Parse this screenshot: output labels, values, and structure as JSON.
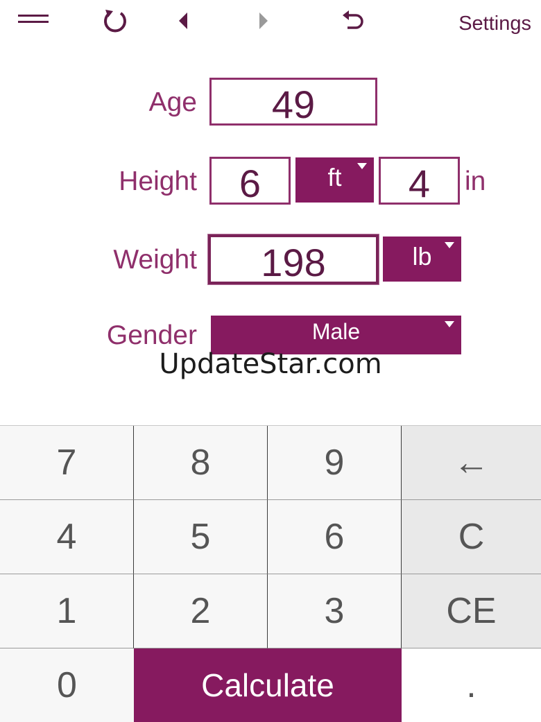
{
  "toolbar": {
    "menu_icon": "menu-icon",
    "reload_icon": "reload-icon",
    "back_icon": "back-arrow-icon",
    "forward_icon": "forward-arrow-icon",
    "undo_icon": "undo-icon",
    "settings_label": "Settings"
  },
  "form": {
    "age_label": "Age",
    "age_value": "49",
    "height_label": "Height",
    "height_feet_value": "6",
    "height_feet_unit": "ft",
    "height_inches_value": "4",
    "height_inches_unit": "in",
    "weight_label": "Weight",
    "weight_value": "198",
    "weight_unit": "lb",
    "gender_label": "Gender",
    "gender_value": "Male"
  },
  "watermark": "UpdateStar.com",
  "keypad": {
    "k7": "7",
    "k8": "8",
    "k9": "9",
    "backspace": "←",
    "k4": "4",
    "k5": "5",
    "k6": "6",
    "clear": "C",
    "k1": "1",
    "k2": "2",
    "k3": "3",
    "clear_entry": "CE",
    "k0": "0",
    "calculate": "Calculate",
    "decimal": "."
  },
  "colors": {
    "accent": "#861a5f",
    "label": "#8f2f6b",
    "text": "#5b1a45"
  }
}
